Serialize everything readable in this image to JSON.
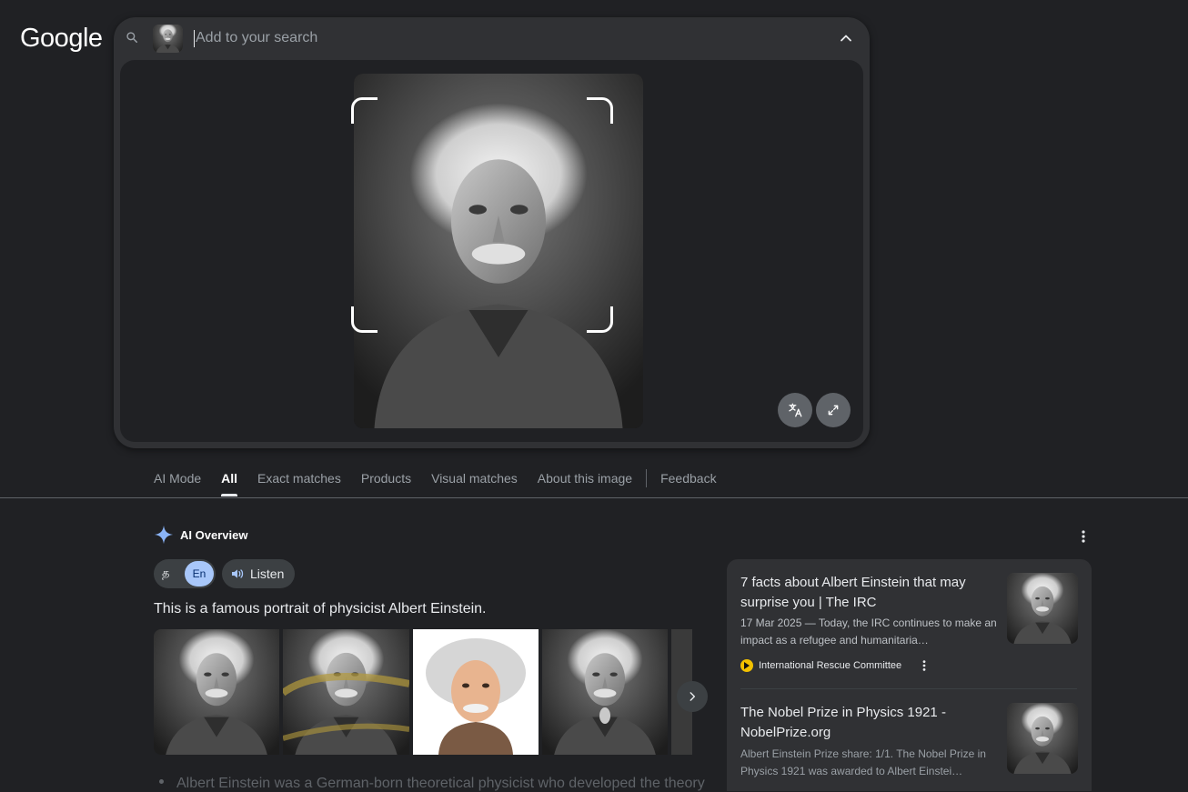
{
  "logo": {
    "text": "Google"
  },
  "search": {
    "placeholder": "Add to your search"
  },
  "tabs": [
    "AI Mode",
    "All",
    "Exact matches",
    "Products",
    "Visual matches",
    "About this image",
    "Feedback"
  ],
  "active_tab": "All",
  "ai_overview": {
    "title": "AI Overview",
    "lang_native": "த",
    "lang_selected": "En",
    "listen_label": "Listen",
    "summary": "This is a famous portrait of physicist Albert Einstein.",
    "bullet": "Albert Einstein was a German-born theoretical physicist who developed the theory"
  },
  "results": [
    {
      "title": "7 facts about Albert Einstein that may surprise you | The IRC",
      "date": "17 Mar 2025",
      "snippet": "Today, the IRC continues to make an impact as a refugee and humanitaria…",
      "source": "International Rescue Committee"
    },
    {
      "title": "The Nobel Prize in Physics 1921 - NobelPrize.org",
      "snippet": "Albert Einstein Prize share: 1/1. The Nobel Prize in Physics 1921 was awarded to Albert Einstei…"
    }
  ],
  "colors": {
    "background": "#202124",
    "surface": "#303134",
    "accent": "#a8c7fa",
    "text": "#e8eaed",
    "muted": "#9aa0a6"
  }
}
